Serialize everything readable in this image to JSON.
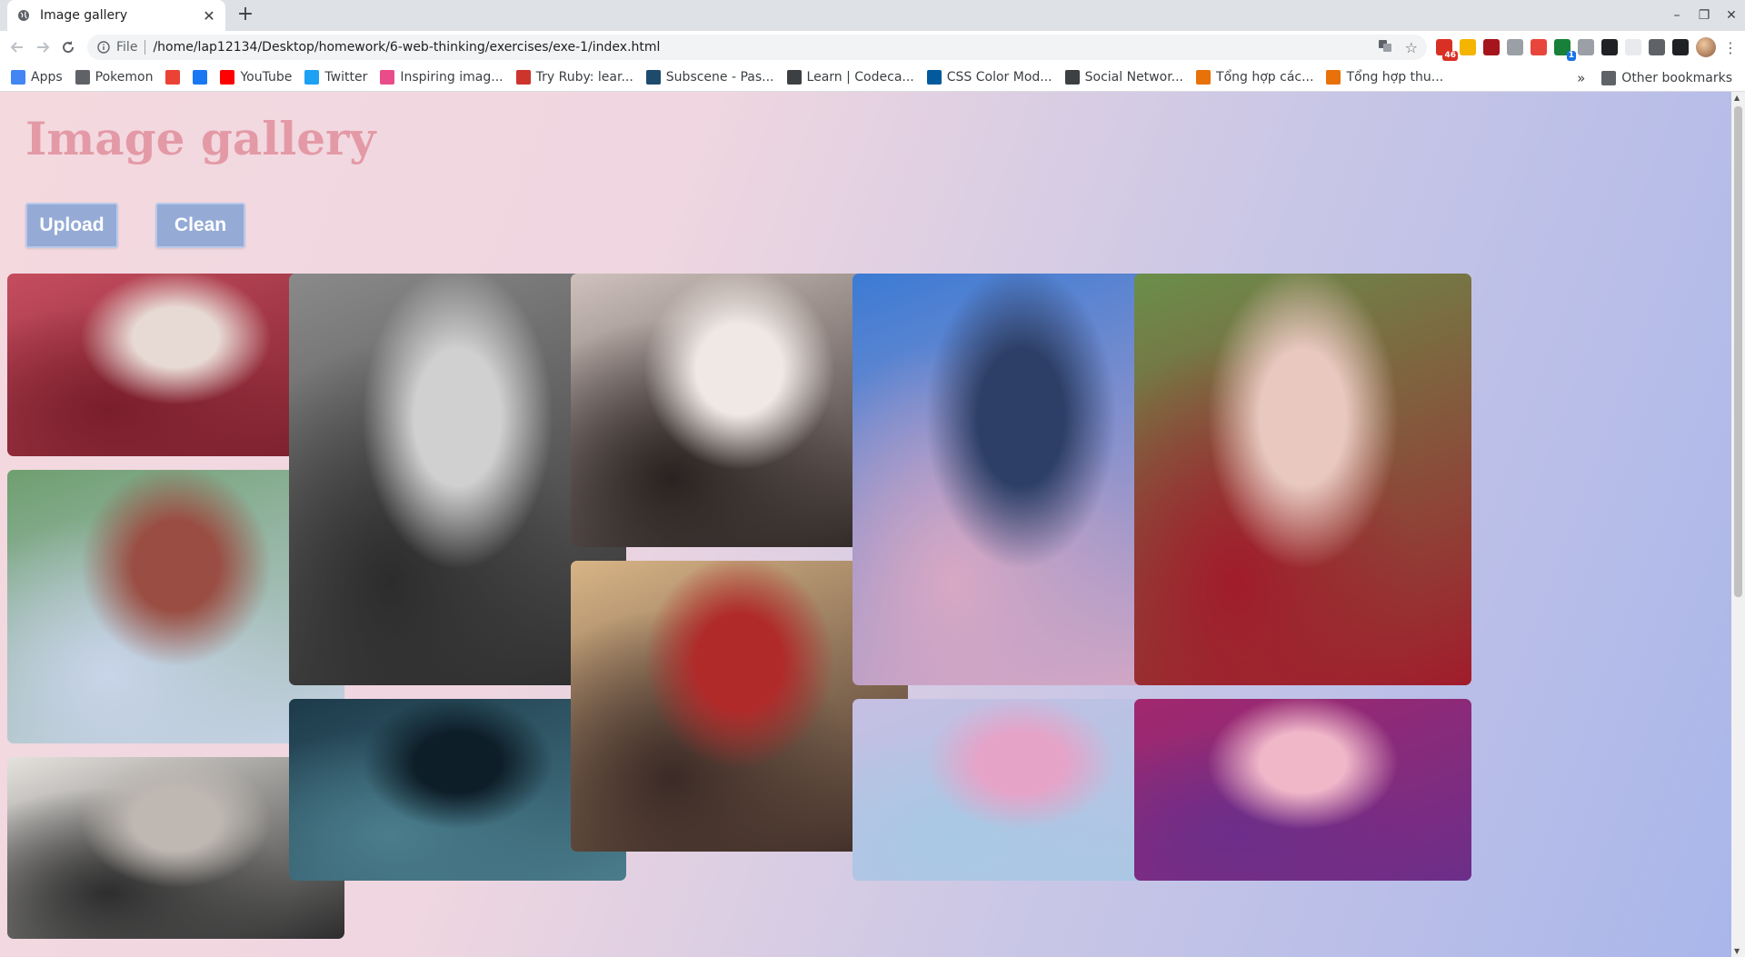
{
  "browser": {
    "tab_title": "Image gallery",
    "url_scheme": "File",
    "url": "/home/lap12134/Desktop/homework/6-web-thinking/exercises/exe-1/index.html",
    "extensions": [
      {
        "icon": "gmail-icon",
        "color": "#d93025",
        "badge": "46"
      },
      {
        "icon": "note-icon",
        "color": "#f4b400",
        "badge": ""
      },
      {
        "icon": "ublock-icon",
        "color": "#a5151b",
        "badge": ""
      },
      {
        "icon": "circle-ext-icon",
        "color": "#9aa0a6",
        "badge": ""
      },
      {
        "icon": "redo-ext-icon",
        "color": "#e8453c",
        "badge": ""
      },
      {
        "icon": "chat-ext-icon",
        "color": "#188038",
        "badge": "1"
      },
      {
        "icon": "camera-icon",
        "color": "#9aa0a6",
        "badge": ""
      },
      {
        "icon": "swirl-ext-icon",
        "color": "#202124",
        "badge": ""
      },
      {
        "icon": "blank-ext-icon",
        "color": "#e8eaed",
        "badge": ""
      },
      {
        "icon": "facebook-ext-icon",
        "color": "#5f6368",
        "badge": ""
      },
      {
        "icon": "ae-ext-icon",
        "color": "#202124",
        "badge": ""
      }
    ]
  },
  "bookmarks": {
    "items": [
      {
        "label": "Apps",
        "icon": "apps-grid-icon",
        "color": "#4285f4"
      },
      {
        "label": "Pokemon",
        "icon": "folder-icon",
        "color": "#5f6368"
      },
      {
        "label": "",
        "icon": "chrome-web-icon",
        "color": "#ea4335"
      },
      {
        "label": "",
        "icon": "facebook-icon",
        "color": "#1877f2"
      },
      {
        "label": "YouTube",
        "icon": "youtube-icon",
        "color": "#ff0000"
      },
      {
        "label": "Twitter",
        "icon": "twitter-icon",
        "color": "#1da1f2"
      },
      {
        "label": "Inspiring imag...",
        "icon": "heart-icon",
        "color": "#ea4c89"
      },
      {
        "label": "Try Ruby: lear...",
        "icon": "ruby-icon",
        "color": "#cc342d"
      },
      {
        "label": "Subscene - Pas...",
        "icon": "subscene-icon",
        "color": "#1d4b6c"
      },
      {
        "label": "Learn | Codeca...",
        "icon": "codecademy-icon",
        "color": "#3c4043"
      },
      {
        "label": "CSS Color Mod...",
        "icon": "w3c-icon",
        "color": "#005a9c"
      },
      {
        "label": "Social Networ...",
        "icon": "codecademy-icon",
        "color": "#3c4043"
      },
      {
        "label": "Tổng hợp các...",
        "icon": "j-icon",
        "color": "#e8710a"
      },
      {
        "label": "Tổng hợp thu...",
        "icon": "j-icon",
        "color": "#e8710a"
      }
    ],
    "overflow": "»",
    "other": "Other bookmarks"
  },
  "page": {
    "title": "Image gallery",
    "upload_label": "Upload",
    "clean_label": "Clean"
  },
  "gallery": {
    "columns": [
      [
        {
          "name": "group-red-suits-photo",
          "colors": [
            "#c44d5e",
            "#7a1e2c",
            "#e7d9d3"
          ]
        },
        {
          "name": "group-pyramid-palms-photo",
          "colors": [
            "#6f9f70",
            "#c9d4ea",
            "#9a4e43"
          ]
        },
        {
          "name": "group-indoor-photo",
          "colors": [
            "#e5e2de",
            "#2d2d2d",
            "#bfb8b2"
          ]
        }
      ],
      [
        {
          "name": "singer-bw-stage-photo",
          "colors": [
            "#8a8a8a",
            "#2c2c2c",
            "#d0d0d0"
          ]
        },
        {
          "name": "man-car-night-photo",
          "colors": [
            "#1d3a4a",
            "#4a7d8c",
            "#0e1e28"
          ]
        }
      ],
      [
        {
          "name": "glasses-selfie-photo",
          "colors": [
            "#cfc2bd",
            "#2a2220",
            "#efe8e4"
          ]
        },
        {
          "name": "group-studio-photo",
          "colors": [
            "#d8b486",
            "#3b2a26",
            "#b02a2a"
          ]
        }
      ],
      [
        {
          "name": "pink-beret-photo",
          "colors": [
            "#3b7bd4",
            "#d8a8c4",
            "#2d3f66"
          ]
        },
        {
          "name": "group-pastel-photo",
          "colors": [
            "#c5bfe3",
            "#a8c8e4",
            "#e6a3c8"
          ]
        }
      ],
      [
        {
          "name": "outdoor-portrait-photo",
          "colors": [
            "#6a8f4b",
            "#a11c2c",
            "#e8c8bf"
          ]
        },
        {
          "name": "stage-portrait-photo",
          "colors": [
            "#a2286d",
            "#6b2e8a",
            "#f0b7c9"
          ]
        }
      ]
    ]
  }
}
